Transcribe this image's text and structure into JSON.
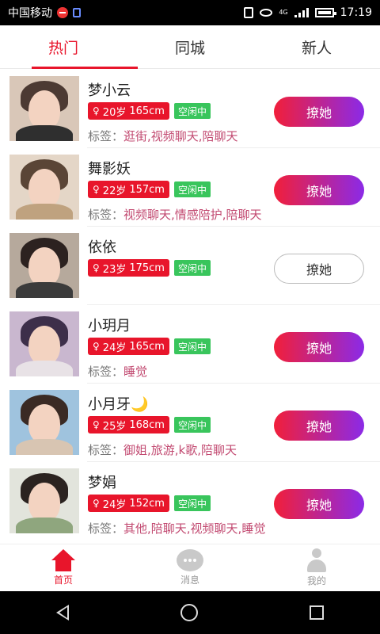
{
  "status_bar": {
    "carrier": "中国移动",
    "network": "4G",
    "time": "17:19"
  },
  "tabs": [
    {
      "label": "热门",
      "active": true
    },
    {
      "label": "同城",
      "active": false
    },
    {
      "label": "新人",
      "active": false
    }
  ],
  "action_label": "撩她",
  "tag_prefix": "标签：",
  "users": [
    {
      "name": "梦小云",
      "sex_symbol": "♀",
      "age": "20岁",
      "height": "165cm",
      "status": "空闲中",
      "tags": "逛街,视频聊天,陪聊天",
      "highlighted": true
    },
    {
      "name": "舞影妖",
      "sex_symbol": "♀",
      "age": "22岁",
      "height": "157cm",
      "status": "空闲中",
      "tags": "视频聊天,情感陪护,陪聊天",
      "highlighted": true
    },
    {
      "name": "依依",
      "sex_symbol": "♀",
      "age": "23岁",
      "height": "175cm",
      "status": "空闲中",
      "tags": "",
      "highlighted": false
    },
    {
      "name": "小玥月",
      "sex_symbol": "♀",
      "age": "24岁",
      "height": "165cm",
      "status": "空闲中",
      "tags": "睡觉",
      "highlighted": true
    },
    {
      "name": "小月牙🌙",
      "sex_symbol": "♀",
      "age": "25岁",
      "height": "168cm",
      "status": "空闲中",
      "tags": "御姐,旅游,k歌,陪聊天",
      "highlighted": true
    },
    {
      "name": "梦娟",
      "sex_symbol": "♀",
      "age": "24岁",
      "height": "152cm",
      "status": "空闲中",
      "tags": "其他,陪聊天,视频聊天,睡觉",
      "highlighted": true
    }
  ],
  "bottom_nav": [
    {
      "label": "首页",
      "icon": "home-icon",
      "active": true
    },
    {
      "label": "消息",
      "icon": "message-icon",
      "active": false
    },
    {
      "label": "我的",
      "icon": "profile-icon",
      "active": false
    }
  ],
  "colors": {
    "accent": "#e8152b",
    "gradient_end": "#8b2ae7",
    "idle_badge": "#39c55c",
    "tag_value": "#c24a71"
  }
}
